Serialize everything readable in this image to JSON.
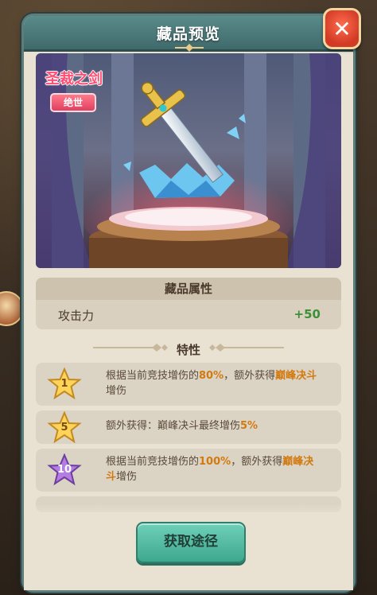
{
  "dialog": {
    "title": "藏品预览",
    "close_icon": "close-icon"
  },
  "item": {
    "name": "圣裁之剑",
    "rarity": "绝世",
    "image_icon": "sword-on-pedestal-illustration"
  },
  "attributes": {
    "header": "藏品属性",
    "rows": [
      {
        "name": "攻击力",
        "value": "+50"
      }
    ]
  },
  "traits": {
    "header": "特性",
    "items": [
      {
        "level": "1",
        "badge_color": "gold",
        "parts": [
          "根据当前竞技增伤的",
          "80%",
          "，额外获得",
          "巅峰决斗",
          "增伤"
        ]
      },
      {
        "level": "5",
        "badge_color": "gold",
        "parts": [
          "额外获得：巅峰决斗最终增伤",
          "5%"
        ]
      },
      {
        "level": "10",
        "badge_color": "purple",
        "parts": [
          "根据当前竞技增伤的",
          "100%",
          "，额外获得",
          "巅峰决斗",
          "增伤"
        ]
      }
    ]
  },
  "footer": {
    "obtain_button": "获取途径"
  }
}
